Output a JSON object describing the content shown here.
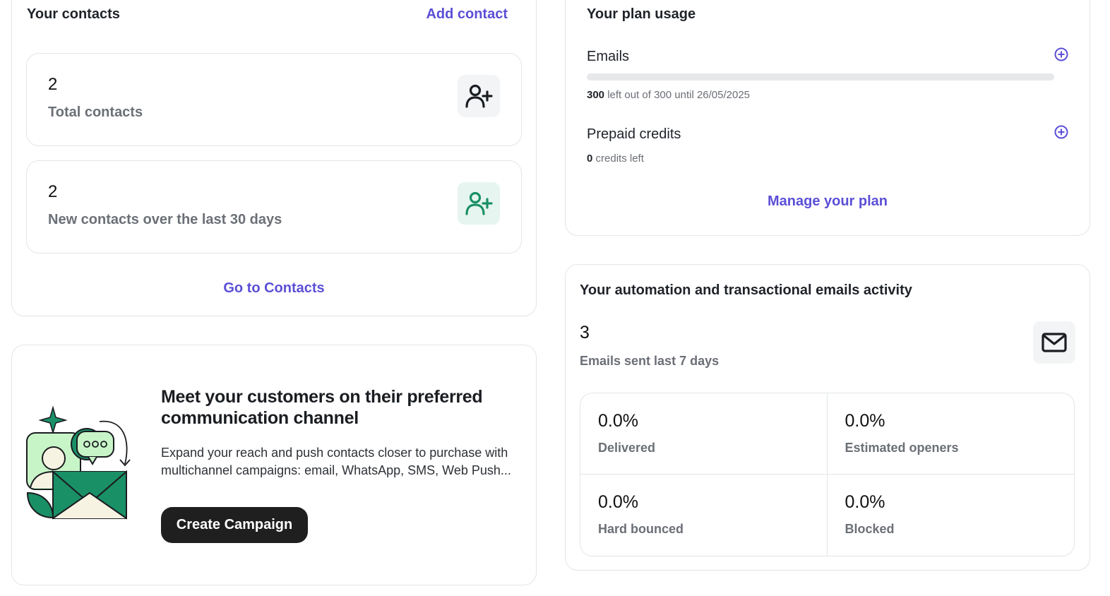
{
  "contacts": {
    "title": "Your contacts",
    "add_link": "Add contact",
    "total": {
      "value": "2",
      "label": "Total contacts"
    },
    "new": {
      "value": "2",
      "label": "New contacts over the last 30 days"
    },
    "go_link": "Go to Contacts"
  },
  "campaign": {
    "title": "Meet your customers on their preferred communication channel",
    "text": "Expand your reach and push contacts closer to purchase with multichannel campaigns: email, WhatsApp, SMS, Web Push...",
    "button": "Create Campaign"
  },
  "plan": {
    "title": "Your plan usage",
    "emails_label": "Emails",
    "emails_used_fraction": 0,
    "emails_left": "300",
    "emails_text": " left out of 300 until 26/05/2025",
    "credits_label": "Prepaid credits",
    "credits_left": "0",
    "credits_text": " credits left",
    "manage_link": "Manage your plan"
  },
  "activity": {
    "title": "Your automation and transactional emails activity",
    "sent_value": "3",
    "sent_label": "Emails sent last 7 days",
    "stats": [
      {
        "value": "0.0%",
        "label": "Delivered"
      },
      {
        "value": "0.0%",
        "label": "Estimated openers"
      },
      {
        "value": "0.0%",
        "label": "Hard bounced"
      },
      {
        "value": "0.0%",
        "label": "Blocked"
      }
    ]
  },
  "colors": {
    "accent": "#5b4fd6",
    "green": "#1a9066",
    "mint_tile": "#e6f5ef",
    "grey_tile": "#f3f4f5"
  }
}
